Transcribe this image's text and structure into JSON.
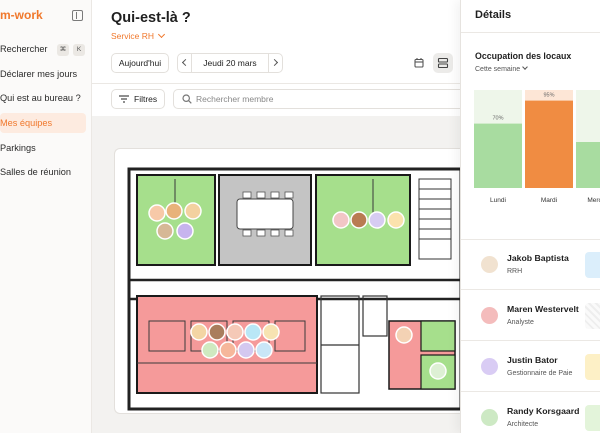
{
  "sidebar": {
    "brand": "m-work",
    "items": [
      {
        "label": "Rechercher",
        "shortcut": [
          "⌘",
          "K"
        ]
      },
      {
        "label": "Déclarer mes jours"
      },
      {
        "label": "Qui est au bureau ?"
      },
      {
        "label": "Mes équipes",
        "active": true
      },
      {
        "label": "Parkings"
      },
      {
        "label": "Salles de réunion"
      }
    ]
  },
  "header": {
    "title": "Qui-est-là ?",
    "service": "Service RH",
    "today_label": "Aujourd'hui",
    "date_label": "Jeudi 20 mars",
    "filters_label": "Filtres",
    "search_placeholder": "Rechercher membre"
  },
  "floorplan": {
    "rooms": [
      {
        "name": "room-green-1",
        "status": "occupied",
        "color": "#8ed37a"
      },
      {
        "name": "room-grey-meeting",
        "status": "unavailable",
        "color": "#bfbfbf"
      },
      {
        "name": "room-green-2",
        "status": "occupied",
        "color": "#8ed37a"
      },
      {
        "name": "room-red-openspace",
        "status": "full",
        "color": "#f28f8f"
      },
      {
        "name": "room-green-3",
        "status": "occupied",
        "color": "#8ed37a"
      }
    ]
  },
  "details": {
    "title": "Détails",
    "occupation_title": "Occupation des locaux",
    "period": "Cette semaine",
    "people": [
      {
        "name": "Jakob Baptista",
        "role": "RRH",
        "tag_color": "#dbeefb"
      },
      {
        "name": "Maren Westervelt",
        "role": "Analyste",
        "tag_color": "#f1f1f1"
      },
      {
        "name": "Justin Bator",
        "role": "Gestionnaire de Paie",
        "tag_color": "#fdf0c6"
      },
      {
        "name": "Randy Korsgaard",
        "role": "Architecte",
        "tag_color": "#e3f4da"
      }
    ]
  },
  "colors": {
    "accent": "#f0782c",
    "green": "#a8dca0",
    "orange": "#f08c42"
  },
  "chart_data": {
    "type": "bar",
    "categories": [
      "Lundi",
      "Mardi",
      "Mercredi"
    ],
    "values": [
      70,
      95,
      50
    ],
    "value_labels": [
      "70%",
      "95%",
      ""
    ],
    "highlight_index": 1,
    "ylim": [
      0,
      100
    ]
  }
}
